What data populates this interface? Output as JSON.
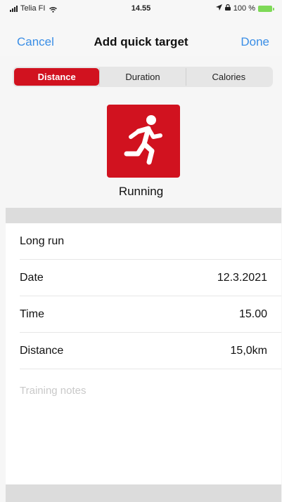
{
  "status_bar": {
    "carrier": "Telia FI",
    "time": "14.55",
    "battery": "100 %"
  },
  "nav": {
    "cancel_label": "Cancel",
    "title": "Add quick target",
    "done_label": "Done"
  },
  "segments": [
    {
      "label": "Distance",
      "selected": true
    },
    {
      "label": "Duration",
      "selected": false
    },
    {
      "label": "Calories",
      "selected": false
    }
  ],
  "activity": {
    "icon": "running-icon",
    "label": "Running"
  },
  "form": {
    "name": "Long run",
    "rows": [
      {
        "label": "Date",
        "value": "12.3.2021"
      },
      {
        "label": "Time",
        "value": "15.00"
      },
      {
        "label": "Distance",
        "value": "15,0km"
      }
    ],
    "notes_placeholder": "Training notes"
  },
  "colors": {
    "accent_red": "#d1121f",
    "link_blue": "#3a8ee6",
    "battery_green": "#7ed957"
  }
}
